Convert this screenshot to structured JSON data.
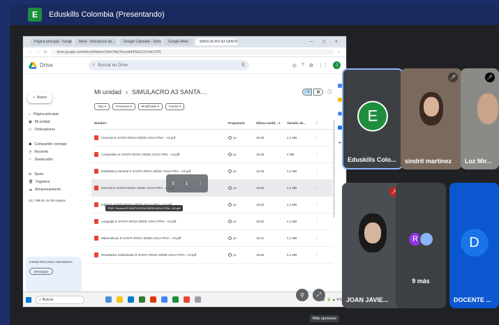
{
  "meeting": {
    "logo_letter": "E",
    "title": "Eduskills Colombia (Presentando)"
  },
  "browser": {
    "tabs": [
      "Pagina principal - Google C...",
      "Meet - Simulacros de...",
      "Google Calendar - Semana...",
      "Google Meet",
      "SIMULACRO A3 SANTA ROSA..."
    ],
    "active_tab": 4,
    "url": "drive.google.com/drive/folders/1AwrVbtyYkrumbFHpGG1UvAcCPG",
    "window_controls": "— ▢ ✕"
  },
  "drive": {
    "app_name": "Drive",
    "search_placeholder": "Buscar en Drive",
    "new_label": "Nuevo",
    "nav": [
      {
        "icon": "home-icon",
        "glyph": "⌂",
        "label": "Página principal"
      },
      {
        "icon": "drive-icon",
        "glyph": "▣",
        "label": "Mi unidad"
      },
      {
        "icon": "computers-icon",
        "glyph": "▭",
        "label": "Ordenadores"
      },
      {
        "icon": "shared-icon",
        "glyph": "☗",
        "label": "Compartido conmigo"
      },
      {
        "icon": "recent-icon",
        "glyph": "◷",
        "label": "Reciente"
      },
      {
        "icon": "starred-icon",
        "glyph": "☆",
        "label": "Destacados"
      },
      {
        "icon": "spam-icon",
        "glyph": "⊘",
        "label": "Spam"
      },
      {
        "icon": "trash-icon",
        "glyph": "🗑",
        "label": "Papelera"
      },
      {
        "icon": "storage-icon",
        "glyph": "☁",
        "label": "Almacenamiento"
      }
    ],
    "storage_text": "10,7 MB de 15 GB usados",
    "promo": {
      "text": "Instala Drive para ordenadores",
      "button": "Descargar"
    },
    "breadcrumb": {
      "root": "Mi unidad",
      "sep": "›",
      "current": "SIMULACRO A3 SANTA ..."
    },
    "filters": [
      "Tipo ▾",
      "Personas ▾",
      "Modificado ▾",
      "Fuente ▾"
    ],
    "columns": {
      "name": "Nombre ↑",
      "owner": "Propietario",
      "date": "Última modif... ▾",
      "size": "Tamaño de..."
    },
    "files": [
      {
        "name": "Ciencias E SANTA ROSA SEDE AGUA FRIA - A3.pdf",
        "owner": "yo",
        "date": "15:46",
        "size": "4,1 MB"
      },
      {
        "name": "Competitivo E SANTA ROSA SEDE AGUA FRIA - A3.pdf",
        "owner": "yo",
        "date": "15:46",
        "size": "4 MB"
      },
      {
        "name": "Estadística General E SANTA ROSA SEDE AGUA FRIA - A3.pdf",
        "owner": "yo",
        "date": "15:46",
        "size": "4,1 MB"
      },
      {
        "name": "General E SANTA ROSA SEDE AGUA FRIA - A3.pdf",
        "owner": "yo",
        "date": "15:52",
        "size": "4,1 MB"
      },
      {
        "name": "Inglés E SANTA ROSA SEDE AGUA FRIA - A3.pdf",
        "owner": "yo",
        "date": "15:52",
        "size": "4,1 MB"
      },
      {
        "name": "Lenguaje E SANTA ROSA SEDE AGUA FRIA - A3.pdf",
        "owner": "yo",
        "date": "15:52",
        "size": "4,1 MB"
      },
      {
        "name": "Matemáticas E SANTA ROSA SEDE AGUA FRIA - A3.pdf",
        "owner": "yo",
        "date": "15:51",
        "size": "4,1 MB"
      },
      {
        "name": "Resultados Individuales E SANTA ROSA SEDE AGUA FRIA - A3.pdf",
        "owner": "yo",
        "date": "15:55",
        "size": "5,1 MB"
      }
    ],
    "tooltip": "PDF: General E SANTA ROSA SEDE AGUA FRIA - A3.pdf"
  },
  "taskbar": {
    "search": "Buscar",
    "tray": "^ 🔊 🔋 ▲ 4:10"
  },
  "participants": [
    {
      "name": "Eduskills Colo...",
      "letter": "E",
      "color": "#1e8e3e",
      "muted": false,
      "active": true
    },
    {
      "name": "sindrit martinez",
      "muted": true
    },
    {
      "name": "Luz Mir...",
      "muted": true
    },
    {
      "name": "JOAN JAVIE...",
      "muted": true
    },
    {
      "name": "9 más",
      "letters": [
        "R",
        ""
      ]
    },
    {
      "name": "DOCENTE ...",
      "letter": "D",
      "color": "#1a73e8"
    }
  ],
  "options_tooltip": "Más opciones"
}
